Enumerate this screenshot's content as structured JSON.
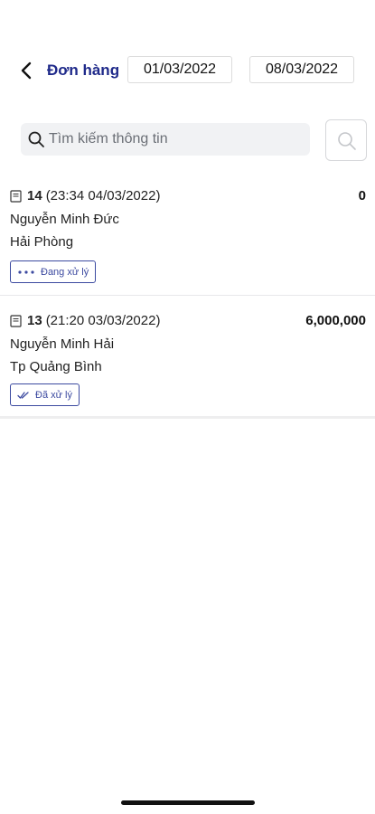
{
  "header": {
    "title": "Đơn hàng",
    "date_from": "01/03/2022",
    "date_to": "08/03/2022"
  },
  "search": {
    "placeholder": "Tìm kiếm thông tin"
  },
  "orders": [
    {
      "id": "14",
      "datetime": "(23:34 04/03/2022)",
      "amount": "0",
      "customer": "Nguyễn Minh Đức",
      "address": "Hải Phòng",
      "status": "Đang xử lý",
      "status_icon": "dots-icon"
    },
    {
      "id": "13",
      "datetime": "(21:20 03/03/2022)",
      "amount": "6,000,000",
      "customer": "Nguyễn Minh Hải",
      "address": "Tp Quảng Bình",
      "status": "Đã xử lý",
      "status_icon": "double-check-icon"
    }
  ],
  "colors": {
    "title": "#1f2a8a",
    "status_border": "#3c4aa0",
    "search_bg": "#f1f2f4"
  }
}
